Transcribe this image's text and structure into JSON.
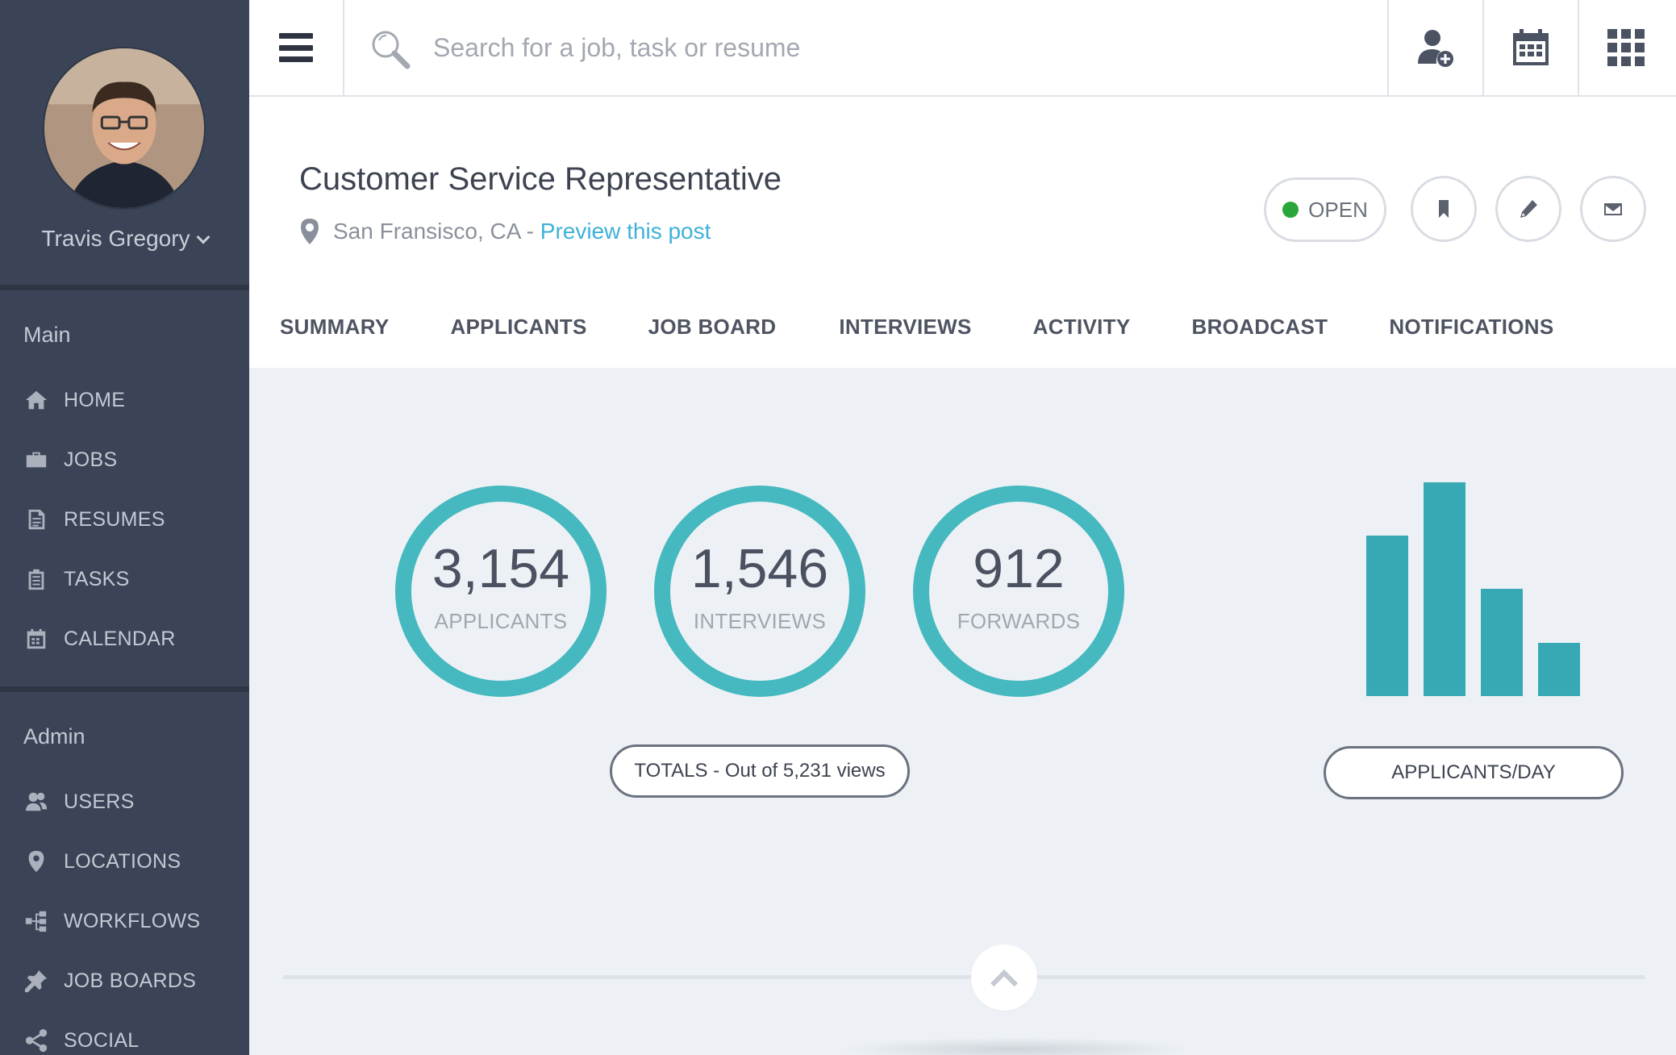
{
  "sidebar": {
    "user_name": "Travis Gregory",
    "sections": [
      {
        "title": "Main",
        "items": [
          {
            "label": "HOME",
            "icon": "home-icon"
          },
          {
            "label": "JOBS",
            "icon": "briefcase-icon"
          },
          {
            "label": "RESUMES",
            "icon": "document-icon"
          },
          {
            "label": "TASKS",
            "icon": "clipboard-icon"
          },
          {
            "label": "CALENDAR",
            "icon": "calendar-icon"
          }
        ]
      },
      {
        "title": "Admin",
        "items": [
          {
            "label": "USERS",
            "icon": "users-icon"
          },
          {
            "label": "LOCATIONS",
            "icon": "location-pin-icon"
          },
          {
            "label": "WORKFLOWS",
            "icon": "workflow-icon"
          },
          {
            "label": "JOB BOARDS",
            "icon": "pushpin-icon"
          },
          {
            "label": "SOCIAL",
            "icon": "share-icon"
          }
        ]
      }
    ]
  },
  "topbar": {
    "search_placeholder": "Search for a job, task or resume",
    "icons": [
      "menu-icon",
      "search-icon",
      "add-user-icon",
      "calendar-icon",
      "apps-grid-icon"
    ]
  },
  "job": {
    "title": "Customer Service Representative",
    "location": "San Fransisco, CA - ",
    "preview_link": "Preview this post",
    "status": "OPEN",
    "status_color": "#2aa63a",
    "action_icons": [
      "bookmark-icon",
      "pencil-icon",
      "envelope-icon"
    ]
  },
  "tabs": [
    "SUMMARY",
    "APPLICANTS",
    "JOB BOARD",
    "INTERVIEWS",
    "ACTIVITY",
    "BROADCAST",
    "NOTIFICATIONS"
  ],
  "stats": [
    {
      "value": "3,154",
      "label": "APPLICANTS"
    },
    {
      "value": "1,546",
      "label": "INTERVIEWS"
    },
    {
      "value": "912",
      "label": "FORWARDS"
    }
  ],
  "totals_label": "TOTALS - Out of 5,231 views",
  "chart_label": "APPLICANTS/DAY",
  "accent_color": "#45b9bf",
  "chart_data": {
    "type": "bar",
    "categories": [
      "",
      "",
      "",
      ""
    ],
    "values": [
      147,
      196,
      98,
      49
    ],
    "ylim": [
      0,
      196
    ],
    "title": "",
    "xlabel": "",
    "ylabel": "APPLICANTS/DAY",
    "bar_color": "#37a9b4",
    "grid": false
  }
}
